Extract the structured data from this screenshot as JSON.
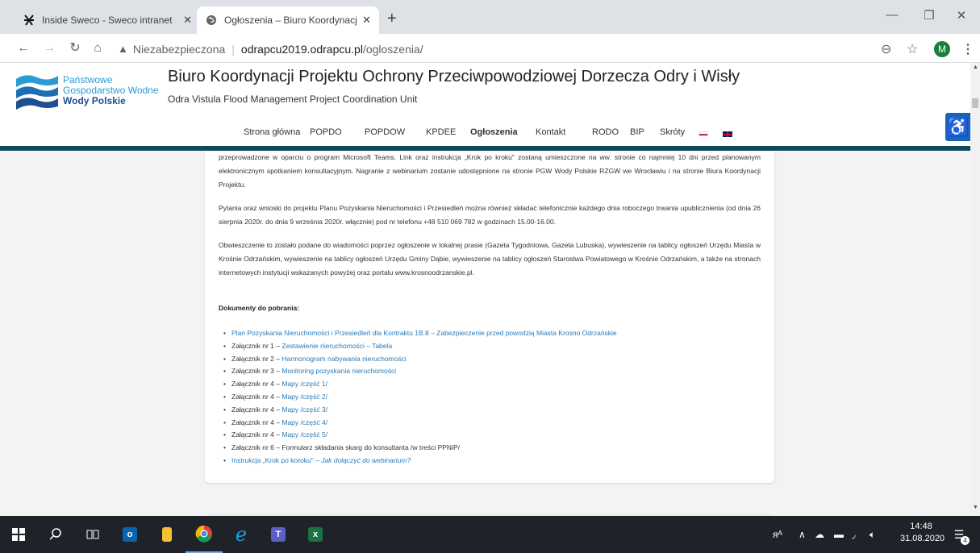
{
  "browser": {
    "tabs": [
      {
        "title": "Inside Sweco - Sweco intranet",
        "active": false
      },
      {
        "title": "Ogłoszenia – Biuro Koordynacji P",
        "active": true
      }
    ],
    "new_tab": "+",
    "window_controls": {
      "minimize": "—",
      "maximize": "❐",
      "close": "✕"
    },
    "address": {
      "insecure_label": "Niezabezpieczona",
      "separator": "|",
      "host": "odrapcu2019.odrapcu.pl",
      "path": "/ogloszenia/"
    },
    "profile_initial": "M",
    "icons": {
      "back": "back-arrow-icon",
      "forward": "forward-arrow-icon",
      "reload": "reload-icon",
      "home": "home-icon",
      "zoom": "zoom-icon",
      "bookmark": "star-icon",
      "menu": "kebab-menu-icon"
    }
  },
  "site": {
    "logo": {
      "line1": "Państwowe",
      "line2": "Gospodarstwo Wodne",
      "line3": "Wody Polskie"
    },
    "title": "Biuro Koordynacji Projektu Ochrony Przeciwpowodziowej Dorzecza Odry i Wisły",
    "subtitle": "Odra Vistula Flood Management Project Coordination Unit",
    "nav": [
      {
        "label": "Strona główna"
      },
      {
        "label": "POPDO"
      },
      {
        "label": "POPDOW"
      },
      {
        "label": "KPDEE"
      },
      {
        "label": "Ogłoszenia",
        "active": true
      },
      {
        "label": "Kontakt"
      },
      {
        "label": "RODO"
      },
      {
        "label": "BIP"
      },
      {
        "label": "Skróty"
      }
    ],
    "colors": {
      "accent_bar": "#0e4b5a",
      "link": "#2a7ab8",
      "accessibility": "#1565c0"
    }
  },
  "content": {
    "para1": "przeprowadzone w oparciu o program Microsoft Teams. Link oraz instrukcja „Krok po kroku\" zostaną umieszczone na ww. stronie co najmniej 10 dni przed planowanym elektronicznym spotkaniem konsultacyjnym. Nagranie z webinarium zostanie udostępnione na stronie PGW Wody Polskie RZGW we Wrocławiu i na stronie Biura Koordynacji Projektu.",
    "para2": "Pytania oraz wnioski do projektu Planu Pozyskania Nieruchomości i Przesiedleń można również składać telefonicznie każdego dnia roboczego trwania upublicznienia (od dnia 26 sierpnia 2020r. do dnia 9 września 2020r. włącznie) pod nr telefonu +48 510 069 782 w godzinach 15.00-16.00.",
    "para3": "Obwieszczenie to zostało podane do wiadomości poprzez ogłoszenie w lokalnej prasie (Gazeta Tygodniowa, Gazeta Lubuska), wywieszenie na tablicy ogłoszeń Urzędu Miasta w Krośnie Odrzańskim, wywieszenie na tablicy ogłoszeń Urzędu Gminy Dąbie, wywieszenie na tablicy ogłoszeń Starostwa Powiatowego w Krośnie Odrzańskim, a także na stronach internetowych instytucji wskazanych powyżej oraz portalu www.krosnoodrzanskie.pl.",
    "docs_heading": "Dokumenty do pobrania:",
    "docs": [
      {
        "prefix": "",
        "link": "Plan Pozyskania Nieruchomości i Przesiedleń dla Kontraktu 1B.8 – Zabezpieczenie przed powodzią Miasta Krosno Odrzańskie"
      },
      {
        "prefix": "Załącznik nr 1 – ",
        "link": "Zestawienie nieruchomości – Tabela"
      },
      {
        "prefix": "Załącznik nr 2 – ",
        "link": "Harmonogram nabywania nieruchomości"
      },
      {
        "prefix": "Załącznik nr 3 – ",
        "link": "Monitoring pozyskania nieruchomości"
      },
      {
        "prefix": "Załącznik nr 4 – ",
        "link": "Mapy /część 1/"
      },
      {
        "prefix": "Załącznik nr 4 – ",
        "link": "Mapy /część 2/"
      },
      {
        "prefix": "Załącznik nr 4 – ",
        "link": "Mapy /część 3/"
      },
      {
        "prefix": "Załącznik nr 4 – ",
        "link": "Mapy /część 4/"
      },
      {
        "prefix": "Załącznik nr 4 – ",
        "link": "Mapy /część 5/"
      },
      {
        "prefix": "Załącznik nr 6 – Formularz składania skarg do konsultanta /w treści PPNiP/",
        "link": ""
      },
      {
        "prefix": "",
        "link": "Instrukcja „Krok po koroku\" – ",
        "link_italic": "Jak dołączyć do webinarium?"
      }
    ]
  },
  "taskbar": {
    "time": "14:48",
    "date": "31.08.2020",
    "notifications": "4"
  }
}
